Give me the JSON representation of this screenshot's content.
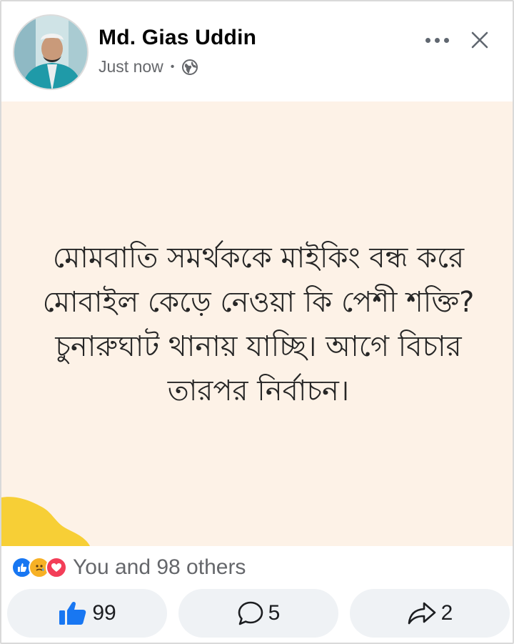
{
  "post": {
    "author": "Md. Gias Uddin",
    "time": "Just now",
    "separator": "•",
    "privacy_icon": "globe-icon",
    "text": "মোমবাতি সমর্থককে মাইকিং বন্ধ করে মোবাইল কেড়ে নেওয়া কি পেশী শক্তি? চুনারুঘাট থানায় যাচ্ছি। আগে বিচার তারপর নির্বাচন।",
    "background_color": "#fdf2e7"
  },
  "reactions": {
    "icons": [
      "like-reaction-icon",
      "care-reaction-icon",
      "love-reaction-icon"
    ],
    "summary": "You and 98 others"
  },
  "actions": {
    "like_count": "99",
    "comment_count": "5",
    "share_count": "2"
  },
  "colors": {
    "like_blue": "#1877f2",
    "love_red": "#f33e58",
    "care_yellow": "#f7b125",
    "muted_text": "#65676b"
  }
}
